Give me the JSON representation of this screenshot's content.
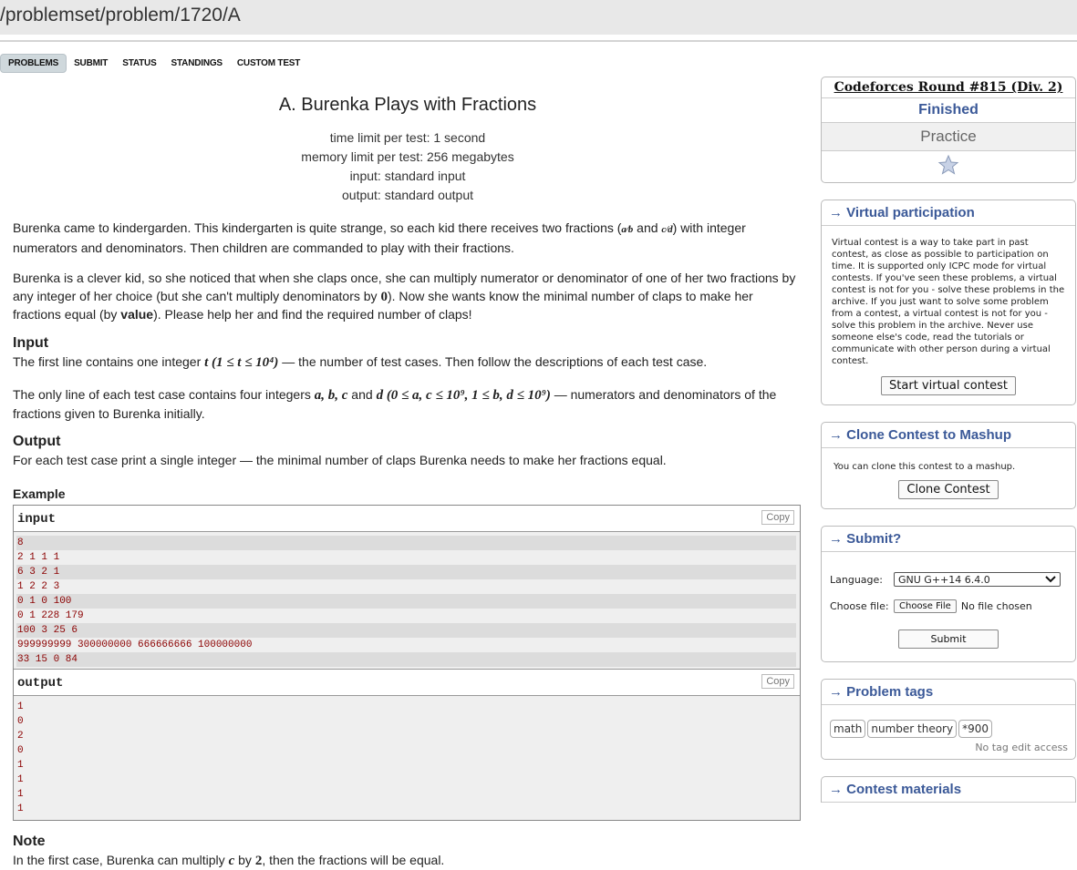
{
  "url": "/problemset/problem/1720/A",
  "tabs": [
    "PROBLEMS",
    "SUBMIT",
    "STATUS",
    "STANDINGS",
    "CUSTOM TEST"
  ],
  "problem": {
    "title": "A. Burenka Plays with Fractions",
    "time_limit": "time limit per test: 1 second",
    "memory_limit": "memory limit per test: 256 megabytes",
    "input": "input: standard input",
    "output": "output: standard output",
    "statement_p1_a": "Burenka came to kindergarden. This kindergarten is quite strange, so each kid there receives two fractions (",
    "statement_p1_b": " and ",
    "statement_p1_c": ") with integer numerators and denominators. Then children are commanded to play with their fractions.",
    "statement_p2_a": "Burenka is a clever kid, so she noticed that when she claps once, she can multiply numerator or denominator of one of her two fractions by any integer of her choice (but she can't multiply denominators by ",
    "statement_p2_zero": "0",
    "statement_p2_b": "). Now she wants know the minimal number of claps to make her fractions equal (by ",
    "statement_p2_bold": "value",
    "statement_p2_c": "). Please help her and find the required number of claps!",
    "input_title": "Input",
    "input_p1_a": "The first line contains one integer ",
    "input_p1_math": "t (1 ≤ t ≤ 10⁴)",
    "input_p1_b": " — the number of test cases. Then follow the descriptions of each test case.",
    "input_p2_a": "The only line of each test case contains four integers ",
    "input_p2_math": "a, b, c",
    "input_p2_and": " and ",
    "input_p2_math2": "d (0 ≤ a, c ≤ 10⁹, 1 ≤ b, d ≤ 10⁹)",
    "input_p2_b": " — numerators and denominators of the fractions given to Burenka initially.",
    "output_title": "Output",
    "output_text": "For each test case print a single integer — the minimal number of claps Burenka needs to make her fractions equal.",
    "example_title": "Example",
    "input_label": "input",
    "output_label": "output",
    "copy_label": "Copy",
    "sample_input": [
      "8",
      "2 1 1 1",
      "6 3 2 1",
      "1 2 2 3",
      "0 1 0 100",
      "0 1 228 179",
      "100 3 25 6",
      "999999999 300000000 666666666 100000000",
      "33 15 0 84"
    ],
    "sample_output": [
      "1",
      "0",
      "2",
      "0",
      "1",
      "1",
      "1",
      "1"
    ],
    "note_title": "Note",
    "note_text_a": "In the first case, Burenka can multiply ",
    "note_math_c": "c",
    "note_text_b": " by ",
    "note_math_2": "2",
    "note_text_c": ", then the fractions will be equal."
  },
  "sidebar": {
    "contest_name": "Codeforces Round #815 (Div. 2)",
    "status": "Finished",
    "practice": "Practice",
    "virtual_title": "→ Virtual participation",
    "virtual_text": "Virtual contest is a way to take part in past contest, as close as possible to participation on time. It is supported only ICPC mode for virtual contests. If you've seen these problems, a virtual contest is not for you - solve these problems in the archive. If you just want to solve some problem from a contest, a virtual contest is not for you - solve this problem in the archive. Never use someone else's code, read the tutorials or communicate with other person during a virtual contest.",
    "start_virtual": "Start virtual contest",
    "clone_title": "→ Clone Contest to Mashup",
    "clone_text": "You can clone this contest to a mashup.",
    "clone_button": "Clone Contest",
    "submit_title": "→ Submit?",
    "language_label": "Language:",
    "language_value": "GNU G++14 6.4.0",
    "choose_file_label": "Choose file:",
    "choose_file_button": "Choose File",
    "no_file": "No file chosen",
    "submit_button": "Submit",
    "tags_title": "→ Problem tags",
    "tags": [
      "math",
      "number theory",
      "*900"
    ],
    "no_tag_edit": "No tag edit access",
    "materials_title": "→ Contest materials"
  },
  "icons": {
    "star": "star-icon",
    "dropdown": "chevron-down-icon"
  }
}
